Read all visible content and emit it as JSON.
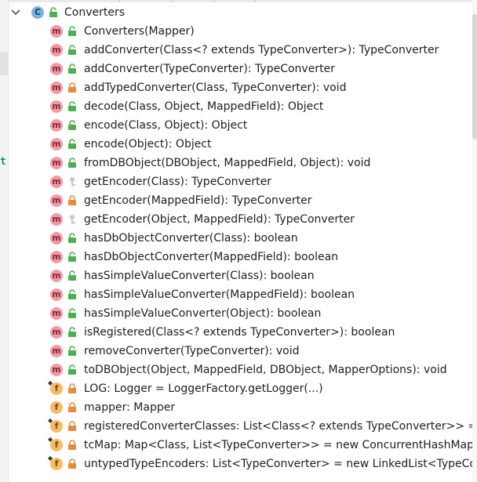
{
  "root": {
    "label": "Converters",
    "expanded": true,
    "kind": "class",
    "access": "public",
    "icon_letter": "C"
  },
  "members": [
    {
      "kind": "method",
      "access": "public",
      "label": "Converters(Mapper)"
    },
    {
      "kind": "method",
      "access": "public",
      "label": "addConverter(Class<? extends TypeConverter>): TypeConverter"
    },
    {
      "kind": "method",
      "access": "public",
      "label": "addConverter(TypeConverter): TypeConverter"
    },
    {
      "kind": "method",
      "access": "private",
      "label": "addTypedConverter(Class, TypeConverter): void"
    },
    {
      "kind": "method",
      "access": "public",
      "label": "decode(Class, Object, MappedField): Object"
    },
    {
      "kind": "method",
      "access": "public",
      "label": "encode(Class, Object): Object"
    },
    {
      "kind": "method",
      "access": "public",
      "label": "encode(Object): Object"
    },
    {
      "kind": "method",
      "access": "public",
      "label": "fromDBObject(DBObject, MappedField, Object): void"
    },
    {
      "kind": "method",
      "access": "protected",
      "label": "getEncoder(Class): TypeConverter"
    },
    {
      "kind": "method",
      "access": "private",
      "label": "getEncoder(MappedField): TypeConverter"
    },
    {
      "kind": "method",
      "access": "protected",
      "label": "getEncoder(Object, MappedField): TypeConverter"
    },
    {
      "kind": "method",
      "access": "public",
      "label": "hasDbObjectConverter(Class): boolean"
    },
    {
      "kind": "method",
      "access": "public",
      "label": "hasDbObjectConverter(MappedField): boolean"
    },
    {
      "kind": "method",
      "access": "public",
      "label": "hasSimpleValueConverter(Class): boolean"
    },
    {
      "kind": "method",
      "access": "public",
      "label": "hasSimpleValueConverter(MappedField): boolean"
    },
    {
      "kind": "method",
      "access": "public",
      "label": "hasSimpleValueConverter(Object): boolean"
    },
    {
      "kind": "method",
      "access": "public",
      "label": "isRegistered(Class<? extends TypeConverter>): boolean"
    },
    {
      "kind": "method",
      "access": "public",
      "label": "removeConverter(TypeConverter): void"
    },
    {
      "kind": "method",
      "access": "public",
      "label": "toDBObject(Object, MappedField, DBObject, MapperOptions): void"
    },
    {
      "kind": "field",
      "access": "private",
      "static": true,
      "label": "LOG: Logger = LoggerFactory.getLogger(...)"
    },
    {
      "kind": "field",
      "access": "private",
      "static": false,
      "label": "mapper: Mapper"
    },
    {
      "kind": "field",
      "access": "private",
      "static": true,
      "label": "registeredConverterClasses: List<Class<? extends TypeConverter>> = new ..."
    },
    {
      "kind": "field",
      "access": "private",
      "static": true,
      "label": "tcMap: Map<Class, List<TypeConverter>> = new ConcurrentHashMap<Class"
    },
    {
      "kind": "field",
      "access": "private",
      "static": true,
      "label": "untypedTypeEncoders: List<TypeConverter> = new LinkedList<TypeConve"
    }
  ],
  "gutter_glyph": "t",
  "colors": {
    "method_badge": "#f19aa5",
    "field_badge": "#f6bb64",
    "class_badge": "#7ab3e0",
    "public_access": "#4caf50",
    "private_access": "#e68a3c",
    "protected_access": "#c9c9c9"
  }
}
